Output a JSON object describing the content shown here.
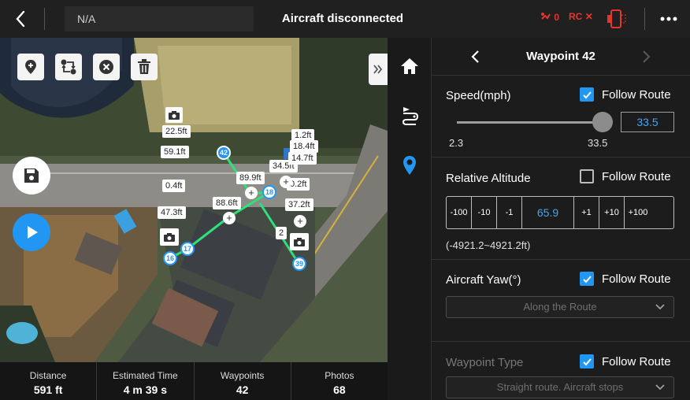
{
  "topbar": {
    "location_text": "N/A",
    "title": "Aircraft disconnected",
    "signal_count": "0",
    "rc_label": "RC",
    "rc_status": "✕",
    "accent_red": "#e8342e"
  },
  "map_tools": {
    "icons": [
      "add-waypoint-icon",
      "reverse-route-icon",
      "delete-icon",
      "trash-icon"
    ]
  },
  "map": {
    "labels": [
      "22.5ft",
      "59.1ft",
      "0.4ft",
      "47.3ft",
      "89.9ft",
      "88.6ft",
      "34.5ft",
      "0.2ft",
      "37.2ft",
      "1.2ft",
      "18.4ft",
      "14.7ft",
      "2"
    ],
    "waypoints": [
      "42",
      "18",
      "17",
      "16",
      "39"
    ],
    "route_color": "#2ee07a",
    "waypoint_color": "#2196f3"
  },
  "stats": [
    {
      "label": "Distance",
      "value": "591 ft"
    },
    {
      "label": "Estimated Time",
      "value": "4 m 39 s"
    },
    {
      "label": "Waypoints",
      "value": "42"
    },
    {
      "label": "Photos",
      "value": "68"
    }
  ],
  "panel": {
    "title": "Waypoint 42",
    "speed": {
      "label": "Speed(mph)",
      "follow_label": "Follow Route",
      "follow_checked": true,
      "value": "33.5",
      "min": "2.3",
      "max": "33.5",
      "level_fraction": 1.0
    },
    "altitude": {
      "label": "Relative Altitude",
      "follow_label": "Follow Route",
      "follow_checked": false,
      "steps": [
        "-100",
        "-10",
        "-1",
        "65.9",
        "+1",
        "+10",
        "+100"
      ],
      "range": "(-4921.2~4921.2ft)"
    },
    "yaw": {
      "label": "Aircraft Yaw(°)",
      "follow_label": "Follow Route",
      "follow_checked": true,
      "selected": "Along the Route"
    },
    "waypoint_type": {
      "label": "Waypoint Type",
      "follow_label": "Follow Route",
      "follow_checked": true,
      "selected": "Straight route. Aircraft stops"
    },
    "accent": "#2196f3"
  }
}
